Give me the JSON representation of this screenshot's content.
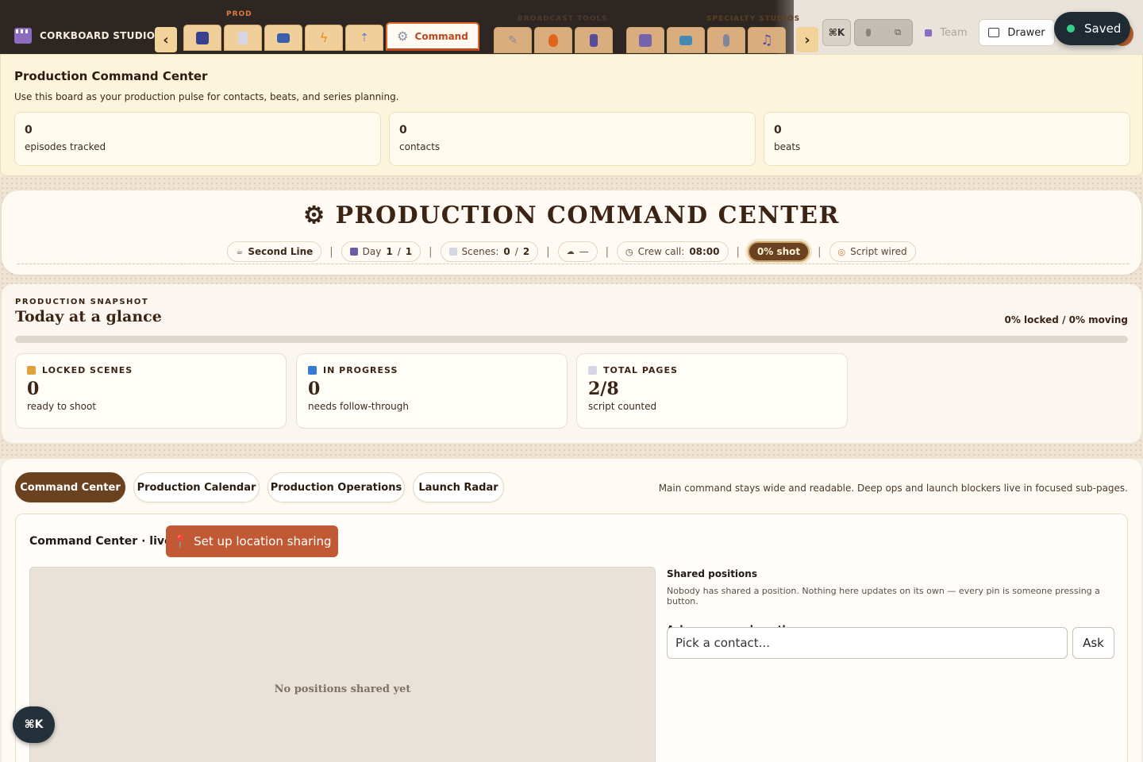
{
  "topbar": {
    "brand": "CORKBOARD STUDIO",
    "groups": {
      "prod": "PROD",
      "broadcast": "BROADCAST TOOLS",
      "specialty": "SPECIALTY STUDIOS"
    },
    "prev_arrow": "‹",
    "next_arrow": "›",
    "prod_tabs": [
      {
        "icon": "floppy-disk-icon",
        "color": "#3b3f8f"
      },
      {
        "icon": "document-icon",
        "color": "#c9c9d6"
      },
      {
        "icon": "film-strip-icon",
        "color": "#3b5fa8"
      },
      {
        "icon": "lightning-icon",
        "color": "#f08a1a"
      },
      {
        "icon": "upload-icon",
        "color": "#6b8ad6"
      }
    ],
    "active_tab": {
      "icon": "gear-icon",
      "label": "Command"
    },
    "broadcast_tabs": [
      {
        "icon": "pen-icon",
        "color": "#9aa0b3"
      },
      {
        "icon": "fire-icon",
        "color": "#f06a1a"
      },
      {
        "icon": "phone-icon",
        "color": "#5b4fa8"
      }
    ],
    "specialty_tabs": [
      {
        "icon": "clapperboard-icon",
        "color": "#7a6ab8"
      },
      {
        "icon": "tv-icon",
        "color": "#4a90c0"
      },
      {
        "icon": "microphone-icon",
        "color": "#8a8fa6"
      },
      {
        "icon": "music-note-icon",
        "color": "#5b4fa8"
      }
    ],
    "cmdk_label": "⌘K",
    "team_label": "Team",
    "drawer_label": "Drawer",
    "saved_label": "Saved"
  },
  "summary": {
    "title": "Production Command Center",
    "description": "Use this board as your production pulse for contacts, beats, and series planning.",
    "cards": [
      {
        "value": "0",
        "label": "episodes tracked"
      },
      {
        "value": "0",
        "label": "contacts"
      },
      {
        "value": "0",
        "label": "beats"
      }
    ]
  },
  "header": {
    "title": "PRODUCTION COMMAND CENTER",
    "title_icon": "⚙",
    "chips": {
      "line": "Second Line",
      "day_label": "Day",
      "day_current": "1",
      "day_sep": "/",
      "day_total": "1",
      "scenes_label": "Scenes:",
      "scenes_current": "0",
      "scenes_sep": "/",
      "scenes_total": "2",
      "weather": "—",
      "crew_label": "Crew call:",
      "crew_time": "08:00",
      "shot": "0% shot",
      "script": "Script wired"
    },
    "separator": "|"
  },
  "snapshot": {
    "eyebrow": "PRODUCTION SNAPSHOT",
    "title": "Today at a glance",
    "ratio": "0% locked / 0% moving",
    "progress": 0,
    "cards": [
      {
        "icon": "lock-icon",
        "title": "LOCKED SCENES",
        "value": "0",
        "sub": "ready to shoot"
      },
      {
        "icon": "refresh-icon",
        "title": "IN PROGRESS",
        "value": "0",
        "sub": "needs follow-through"
      },
      {
        "icon": "page-icon",
        "title": "TOTAL PAGES",
        "value": "2/8",
        "sub": "script counted"
      }
    ]
  },
  "panel": {
    "tabs": [
      "Command Center",
      "Production Calendar",
      "Production Operations",
      "Launch Radar"
    ],
    "hint": "Main command stays wide and readable. Deep ops and launch blockers live in focused sub-pages.",
    "live_title": "Command Center · live",
    "location_button": "Set up location sharing",
    "map_empty": "No positions shared yet",
    "shared_title": "Shared positions",
    "shared_desc": "Nobody has shared a position. Nothing here updates on its own — every pin is someone pressing a button.",
    "ask_title": "Ask someone where they are",
    "contact_placeholder": "Pick a contact...",
    "ask_button": "Ask"
  },
  "fab": {
    "label": "⌘K"
  }
}
